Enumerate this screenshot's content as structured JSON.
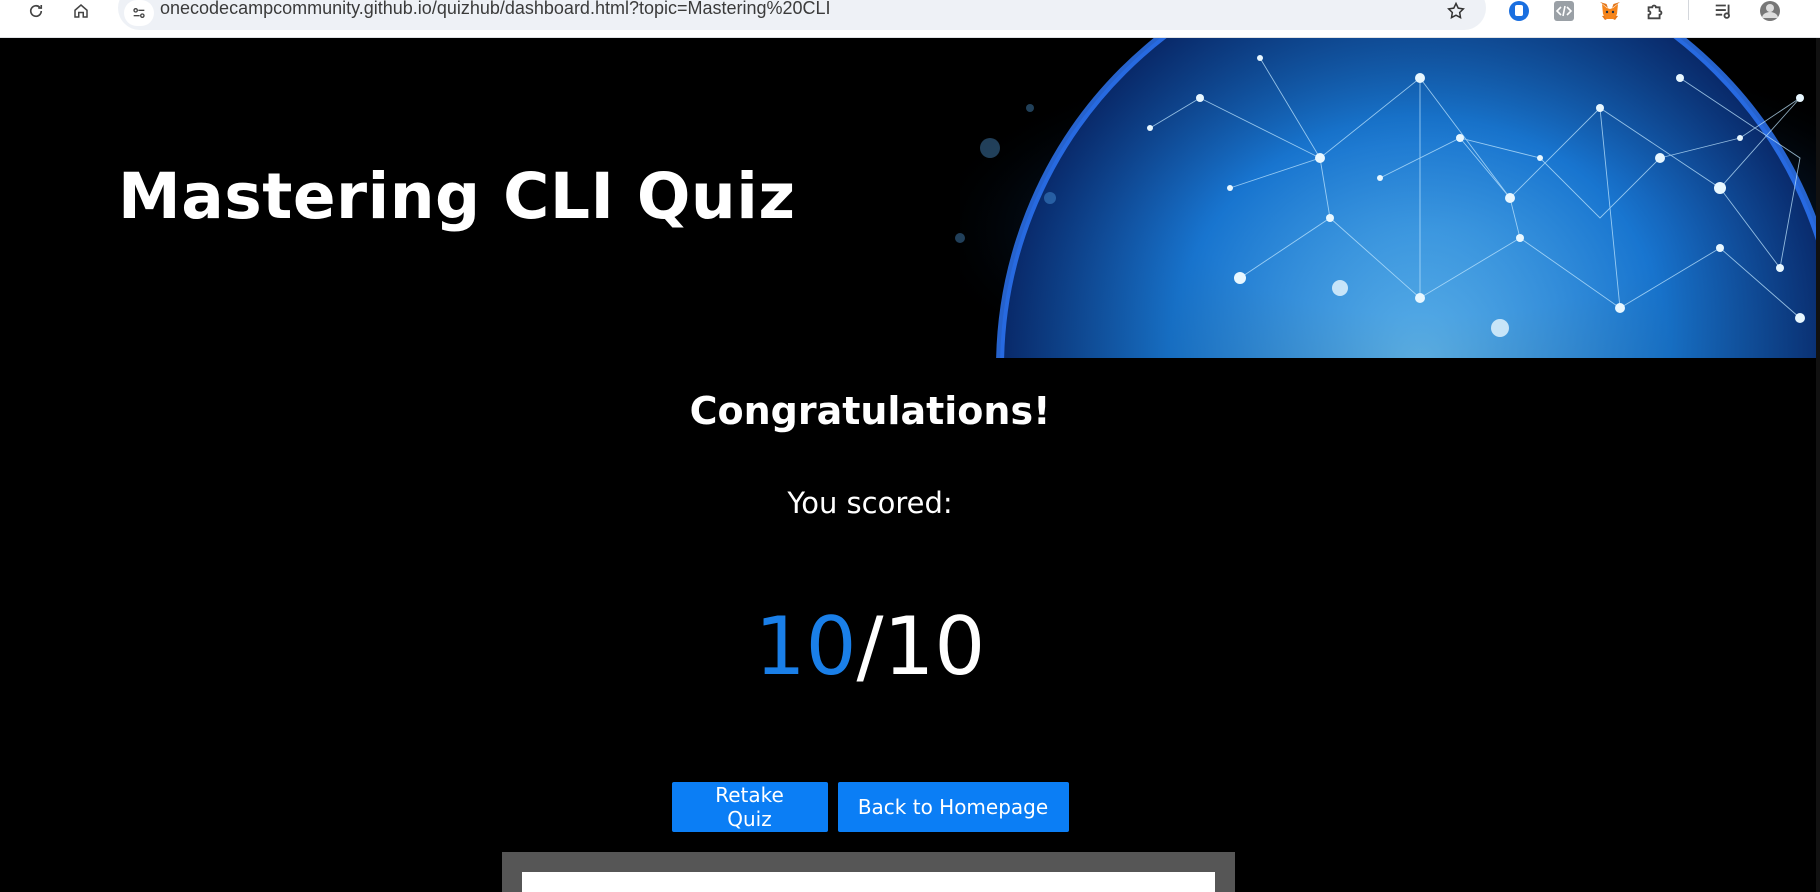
{
  "browser": {
    "url": "onecodecampcommunity.github.io/quizhub/dashboard.html?topic=Mastering%20CLI",
    "icons": [
      "reload-icon",
      "home-icon",
      "site-info-icon",
      "bookmark-star-icon",
      "extension-bitwarden-icon",
      "extension-devtools-icon",
      "extension-metamask-icon",
      "extensions-puzzle-icon",
      "media-queue-icon",
      "profile-avatar-icon"
    ]
  },
  "hero": {
    "title": "Mastering CLI Quiz"
  },
  "results": {
    "heading": "Congratulations!",
    "label": "You scored:",
    "score": "10",
    "separator": "/",
    "total": "10"
  },
  "actions": {
    "retake_label": "Retake Quiz",
    "home_label": "Back to Homepage"
  },
  "colors": {
    "accent": "#0b7ef5",
    "score_highlight": "#1a7fe8",
    "background": "#000000",
    "panel": "#565656"
  }
}
